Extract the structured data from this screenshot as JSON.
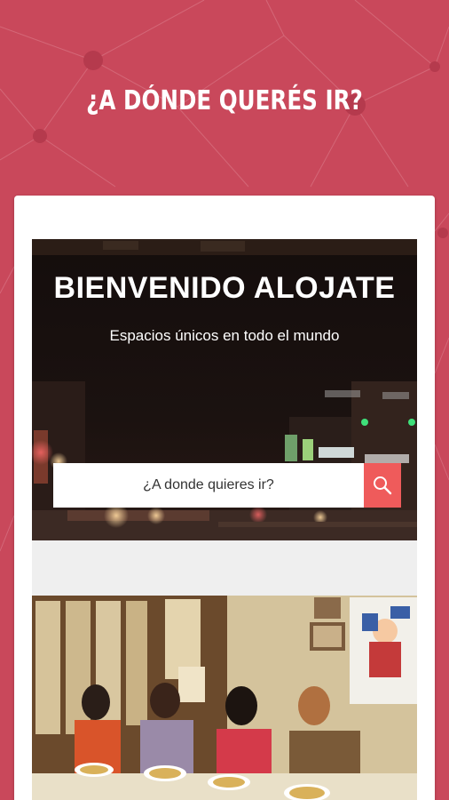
{
  "header": {
    "title": "¿A DÓNDE QUERÉS IR?"
  },
  "hero": {
    "title": "BIENVENIDO ALOJATE",
    "subtitle": "Espacios únicos en todo el mundo",
    "search": {
      "placeholder": "¿A donde quieres ir?",
      "button_icon": "search-icon"
    }
  },
  "colors": {
    "background": "#c9485b",
    "accent": "#ef5b5b",
    "card": "#ffffff"
  }
}
